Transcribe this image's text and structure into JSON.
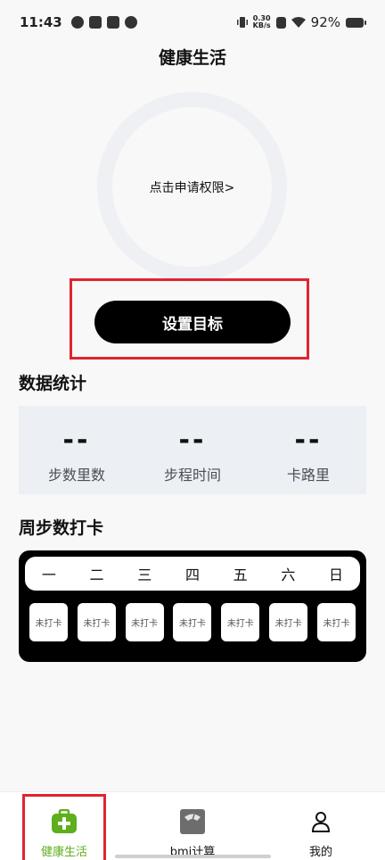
{
  "status_bar": {
    "time": "11:43",
    "net_speed_value": "0.30",
    "net_speed_unit": "KB/s",
    "battery": "92%"
  },
  "page": {
    "title": "健康生活"
  },
  "ring": {
    "permission_text": "点击申请权限>"
  },
  "goal_button": {
    "label": "设置目标"
  },
  "stats": {
    "title": "数据统计",
    "items": [
      {
        "value": "--",
        "label": "步数里数"
      },
      {
        "value": "--",
        "label": "步程时间"
      },
      {
        "value": "--",
        "label": "卡路里"
      }
    ]
  },
  "weekly": {
    "title": "周步数打卡",
    "days": [
      "一",
      "二",
      "三",
      "四",
      "五",
      "六",
      "日"
    ],
    "status": [
      "未打卡",
      "未打卡",
      "未打卡",
      "未打卡",
      "未打卡",
      "未打卡",
      "未打卡"
    ]
  },
  "nav": {
    "items": [
      {
        "label": "健康生活",
        "icon": "first-aid-kit-icon"
      },
      {
        "label": "bmi计算",
        "icon": "scale-icon"
      },
      {
        "label": "我的",
        "icon": "person-icon"
      }
    ],
    "active_color": "#5fae1c"
  },
  "colors": {
    "highlight": "#e0242f",
    "ring": "#eef0f4",
    "card": "#eceff3"
  }
}
